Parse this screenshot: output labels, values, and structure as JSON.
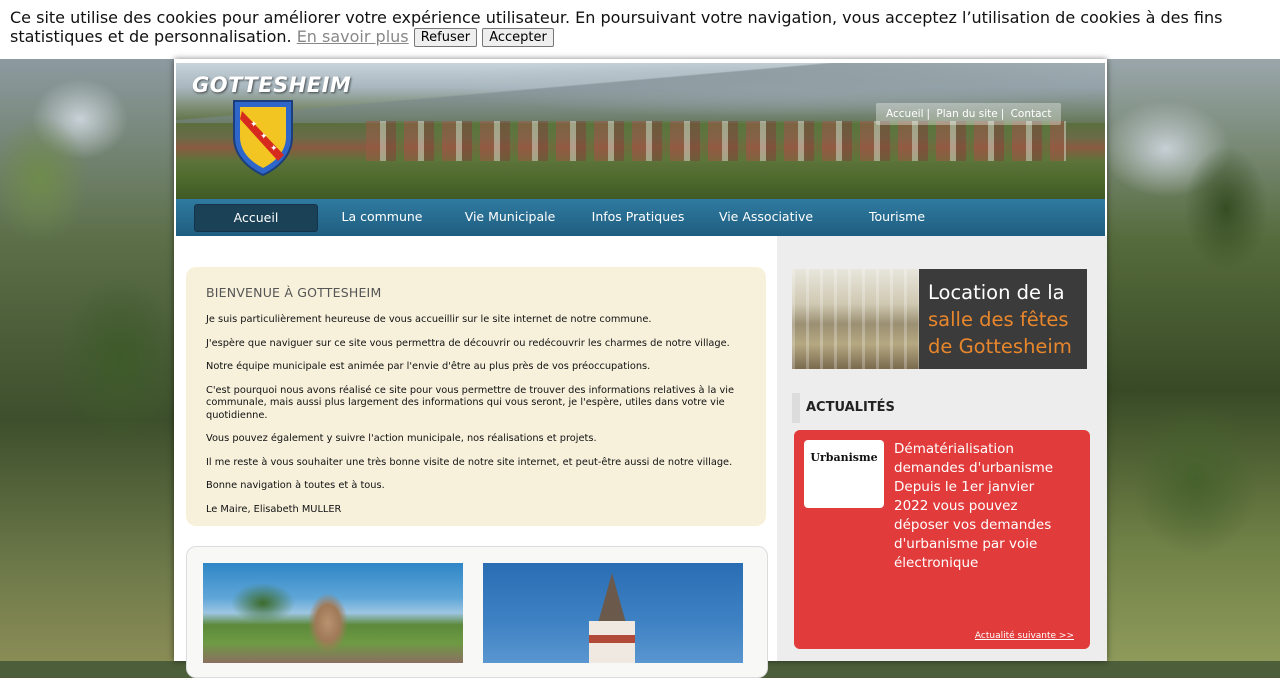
{
  "cookie_bar": {
    "message": "Ce site utilise des cookies pour améliorer votre expérience utilisateur. En poursuivant votre navigation, vous acceptez l’utilisation de cookies à des fins statistiques et de personnalisation.",
    "learn_more": "En savoir plus",
    "refuse": "Refuser",
    "accept": "Accepter"
  },
  "header": {
    "site_title": "GOTTESHEIM",
    "top_links": [
      "Accueil",
      "Plan du site",
      "Contact"
    ]
  },
  "nav": {
    "items": [
      "Accueil",
      "La commune",
      "Vie Municipale",
      "Infos Pratiques",
      "Vie Associative",
      "Tourisme"
    ],
    "active": "Accueil"
  },
  "welcome": {
    "title": "BIENVENUE À GOTTESHEIM",
    "paragraphs": [
      "Je suis particulièrement heureuse de vous accueillir sur le site internet de notre commune.",
      "J'espère que naviguer sur ce site vous permettra de découvrir ou redécouvrir les charmes de notre village.",
      "Notre équipe municipale est animée par l'envie d'être au plus près de vos préoccupations.",
      "C'est pourquoi nous avons réalisé ce site pour vous permettre de trouver des informations relatives à la vie communale, mais aussi plus largement des informations qui vous seront, je l'espère, utiles dans votre vie quotidienne.",
      "Vous pouvez également y suivre l'action municipale, nos réalisations et projets.",
      "Il me reste à vous souhaiter une très bonne visite de notre site internet, et peut-être aussi de notre village.",
      "Bonne navigation à toutes et à tous.",
      "Le Maire, Elisabeth MULLER"
    ]
  },
  "sidebar": {
    "hall_banner": {
      "line1": "Location de la",
      "line2": "salle des fêtes",
      "line3": "de Gottesheim"
    },
    "news": {
      "title": "ACTUALITÉS",
      "tag": "Urbanisme",
      "headline": "Dématérialisation demandes d'urbanisme Depuis le 1er janvier 2022 vous pouvez déposer vos demandes d'urbanisme par voie électronique",
      "next_link": "Actualité suivante >>"
    }
  },
  "colors": {
    "nav_bg": "#1f5e80",
    "nav_active": "#1b4157",
    "welcome_bg": "#f7f1dc",
    "news_bg": "#e23b3b",
    "banner_accent": "#e8862c"
  }
}
